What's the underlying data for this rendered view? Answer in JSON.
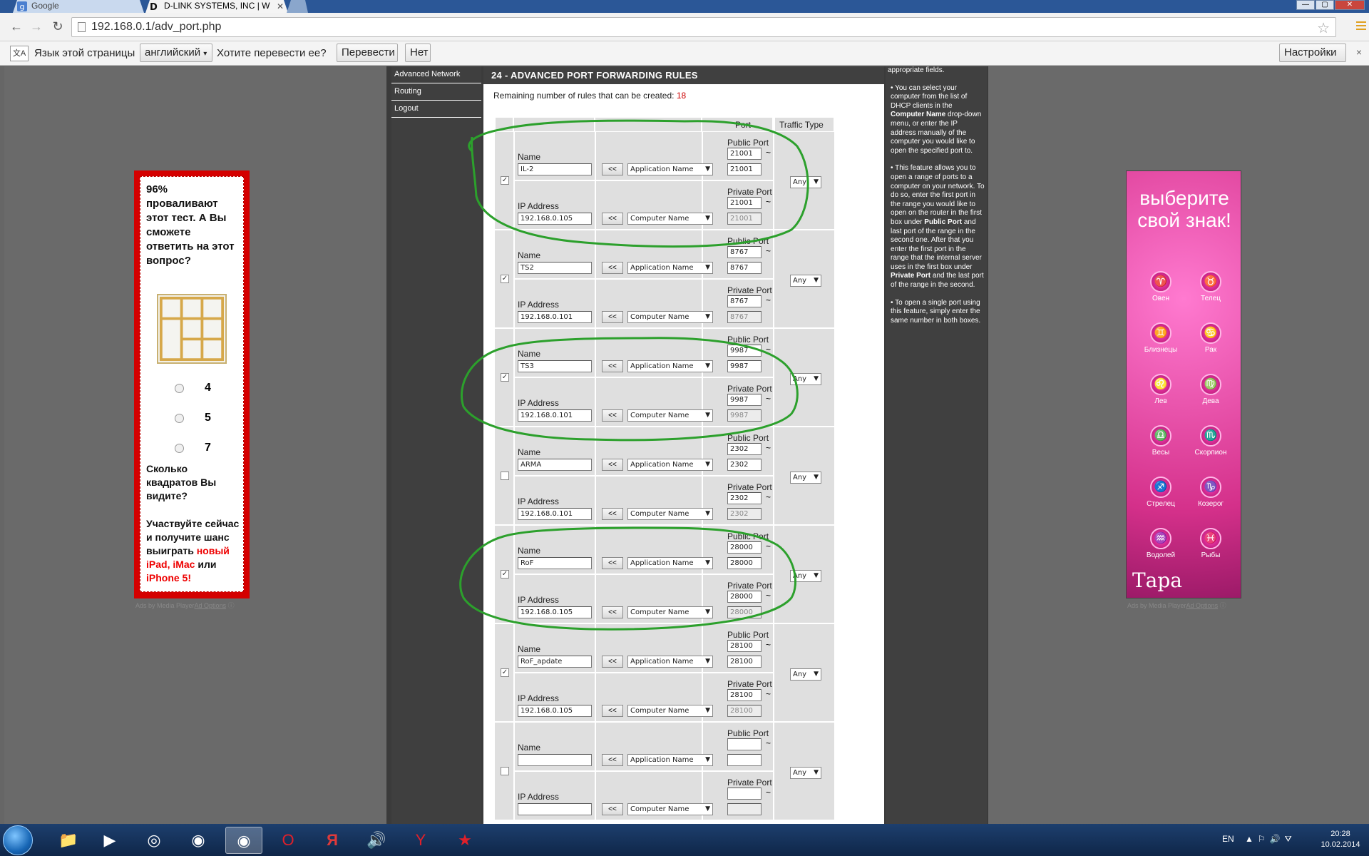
{
  "browser": {
    "tabs": [
      {
        "title": "Google",
        "icon": "google-favicon",
        "active": false
      },
      {
        "title": "D-LINK SYSTEMS, INC | W",
        "icon": "dlink-favicon",
        "active": true
      }
    ],
    "url": "192.168.0.1/adv_port.php"
  },
  "translate_bar": {
    "page_language_label": "Язык этой страницы",
    "language_value": "английский",
    "question": "Хотите перевести ее?",
    "translate_button": "Перевести",
    "no_button": "Нет",
    "settings_button": "Настройки",
    "close_symbol": "×"
  },
  "nav": {
    "items": [
      "Advanced Network",
      "Routing",
      "Logout"
    ]
  },
  "section": {
    "title": "24 - ADVANCED PORT FORWARDING RULES",
    "remaining_label": "Remaining number of rules that can be created:",
    "remaining_count": "18",
    "col_port": "Port",
    "col_traffic": "Traffic Type",
    "name_label": "Name",
    "ip_label": "IP Address",
    "public_port_label": "Public Port",
    "private_port_label": "Private Port",
    "arrow_label": "<<",
    "app_select": "Application Name",
    "computer_select": "Computer Name",
    "tilde": "~",
    "traffic_value": "Any"
  },
  "rules": [
    {
      "checked": true,
      "name": "IL-2",
      "ip": "192.168.0.105",
      "pub_start": "21001",
      "pub_end": "21001",
      "priv_start": "21001",
      "priv_end": "21001"
    },
    {
      "checked": true,
      "name": "TS2",
      "ip": "192.168.0.101",
      "pub_start": "8767",
      "pub_end": "8767",
      "priv_start": "8767",
      "priv_end": "8767"
    },
    {
      "checked": true,
      "name": "TS3",
      "ip": "192.168.0.101",
      "pub_start": "9987",
      "pub_end": "9987",
      "priv_start": "9987",
      "priv_end": "9987"
    },
    {
      "checked": false,
      "name": "ARMA",
      "ip": "192.168.0.101",
      "pub_start": "2302",
      "pub_end": "2302",
      "priv_start": "2302",
      "priv_end": "2302"
    },
    {
      "checked": true,
      "name": "RoF",
      "ip": "192.168.0.105",
      "pub_start": "28000",
      "pub_end": "28000",
      "priv_start": "28000",
      "priv_end": "28000"
    },
    {
      "checked": true,
      "name": "RoF_apdate",
      "ip": "192.168.0.105",
      "pub_start": "28100",
      "pub_end": "28100",
      "priv_start": "28100",
      "priv_end": "28100"
    },
    {
      "checked": false,
      "name": "",
      "ip": "",
      "pub_start": "",
      "pub_end": "",
      "priv_start": "",
      "priv_end": ""
    }
  ],
  "help": {
    "p0": "appropriate fields.",
    "p1a": "• You can select your computer from the list of DHCP clients in the ",
    "p1b": "Computer Name",
    "p1c": " drop-down menu, or enter the IP address manually of the computer you would like to open the specified port to.",
    "p2a": "• This feature allows you to open a range of ports to a computer on your network. To do so, enter the first port in the range you would like to open on the router in the first box under ",
    "p2b": "Public Port",
    "p2c": " and last port of the range in the second one. After that you enter the first port in the range that the internal server uses in the first box under ",
    "p2d": "Private Port",
    "p2e": " and the last port of the range in the second.",
    "p3": "• To open a single port using this feature, simply enter the same number in both boxes."
  },
  "ad_left": {
    "question": "96% проваливают этот тест. А Вы сможете ответить на этот вопрос?",
    "options": [
      "4",
      "5",
      "7"
    ],
    "q2": "Сколько квадратов Вы видите?",
    "cta_a": "Участвуйте сейчас и получите шанс выиграть ",
    "cta_red1": "новый iPad, iMac",
    "cta_b": " или ",
    "cta_red2": "iPhone 5!",
    "caption": "Ads by Media Player",
    "caption_link": "Ad Options"
  },
  "ad_right": {
    "headline": "выберите свой знак!",
    "signs": [
      {
        "name": "Овен",
        "glyph": "♈"
      },
      {
        "name": "Телец",
        "glyph": "♉"
      },
      {
        "name": "Близнецы",
        "glyph": "♊"
      },
      {
        "name": "Рак",
        "glyph": "♋"
      },
      {
        "name": "Лев",
        "glyph": "♌"
      },
      {
        "name": "Дева",
        "glyph": "♍"
      },
      {
        "name": "Весы",
        "glyph": "♎"
      },
      {
        "name": "Скорпион",
        "glyph": "♏"
      },
      {
        "name": "Стрелец",
        "glyph": "♐"
      },
      {
        "name": "Козерог",
        "glyph": "♑"
      },
      {
        "name": "Водолей",
        "glyph": "♒"
      },
      {
        "name": "Рыбы",
        "glyph": "♓"
      }
    ],
    "brand": "Тара",
    "caption": "Ads by Media Player",
    "caption_link": "Ad Options"
  },
  "taskbar": {
    "language": "EN",
    "time": "20:28",
    "date": "10.02.2014"
  },
  "colors": {
    "highlight_oval": "#2ca02c",
    "remaining_count": "#cc0000"
  }
}
